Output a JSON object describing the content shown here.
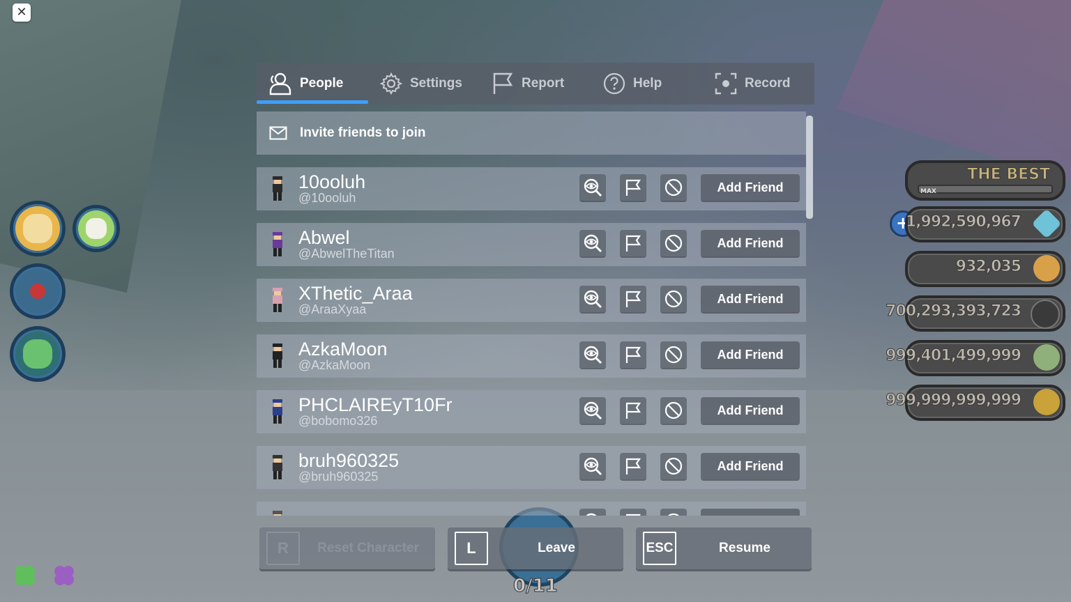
{
  "tabs": [
    {
      "label": "People",
      "icon": "people-icon",
      "active": true
    },
    {
      "label": "Settings",
      "icon": "gear-icon",
      "active": false
    },
    {
      "label": "Report",
      "icon": "flag-icon",
      "active": false
    },
    {
      "label": "Help",
      "icon": "help-icon",
      "active": false
    },
    {
      "label": "Record",
      "icon": "record-icon",
      "active": false
    }
  ],
  "invite": {
    "label": "Invite friends to join",
    "icon": "mail-icon"
  },
  "players": [
    {
      "display": "10ooluh",
      "username": "@10ooluh",
      "action": "Add Friend"
    },
    {
      "display": "Abwel",
      "username": "@AbwelTheTitan",
      "action": "Add Friend"
    },
    {
      "display": "XThetic_Araa",
      "username": "@AraaXyaa",
      "action": "Add Friend"
    },
    {
      "display": "AzkaMoon",
      "username": "@AzkaMoon",
      "action": "Add Friend"
    },
    {
      "display": "PHCLAIREyT10Fr",
      "username": "@bobomo326",
      "action": "Add Friend"
    },
    {
      "display": "bruh960325",
      "username": "@bruh960325",
      "action": "Add Friend"
    }
  ],
  "bottom": {
    "reset": {
      "key": "R",
      "label": "Reset Character",
      "disabled": true
    },
    "leave": {
      "key": "L",
      "label": "Leave"
    },
    "resume": {
      "key": "ESC",
      "label": "Resume"
    }
  },
  "hud": {
    "best_title": "THE BEST",
    "best_max": "MAX",
    "stats": [
      "1,992,590,967",
      "932,035",
      "700,293,393,723",
      "999,401,499,999",
      "999,999,999,999"
    ],
    "counter": "0/11"
  },
  "close_label": "✕"
}
